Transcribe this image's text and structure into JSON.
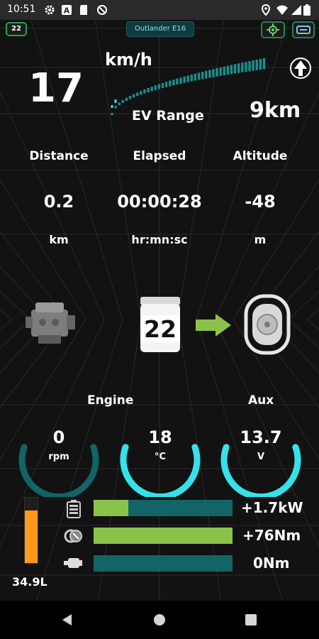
{
  "status_bar": {
    "time": "10:51",
    "icons": [
      "gear-icon",
      "font-icon",
      "sd-card-icon",
      "sync-off-icon",
      "location-icon",
      "wifi-icon",
      "signal-icon",
      "battery-icon"
    ]
  },
  "header": {
    "left_badge": "22",
    "title": "Outlander E16",
    "right_icons": [
      "gps-icon",
      "connection-icon"
    ]
  },
  "speed": {
    "value": "17",
    "unit": "km/h"
  },
  "ev_range": {
    "label": "EV Range",
    "value": "9km",
    "level": 0.9
  },
  "stats": [
    {
      "label": "Distance",
      "value": "0.2",
      "unit": "km"
    },
    {
      "label": "Elapsed",
      "value": "00:00:28",
      "unit": "hr:mn:sc"
    },
    {
      "label": "Altitude",
      "value": "-48",
      "unit": "m"
    }
  ],
  "drivetrain": {
    "battery_badge": "22",
    "icons": [
      "engine-icon",
      "battery-pack-icon",
      "arrow-right-icon",
      "wheel-icon"
    ]
  },
  "gauges": {
    "engine_label": "Engine",
    "aux_label": "Aux",
    "items": [
      {
        "value": "0",
        "unit": "rpm",
        "color": "#136466"
      },
      {
        "value": "18",
        "unit": "°C",
        "color": "#35e2ea"
      },
      {
        "value": "13.7",
        "unit": "V",
        "color": "#35e2ea"
      }
    ]
  },
  "bars": [
    {
      "icon": "battery-icon",
      "value": "+1.7kW",
      "fill": 0.25
    },
    {
      "icon": "motor-icon",
      "value": "+76Nm",
      "fill": 1.0
    },
    {
      "icon": "engine-small-icon",
      "value": "0Nm",
      "fill": 0
    }
  ],
  "fuel": {
    "value": "34.9L",
    "level": 0.8
  },
  "colors": {
    "teal": "#136466",
    "cyan": "#35e2ea",
    "green": "#8bc34a",
    "orange": "#ff9a1a"
  }
}
